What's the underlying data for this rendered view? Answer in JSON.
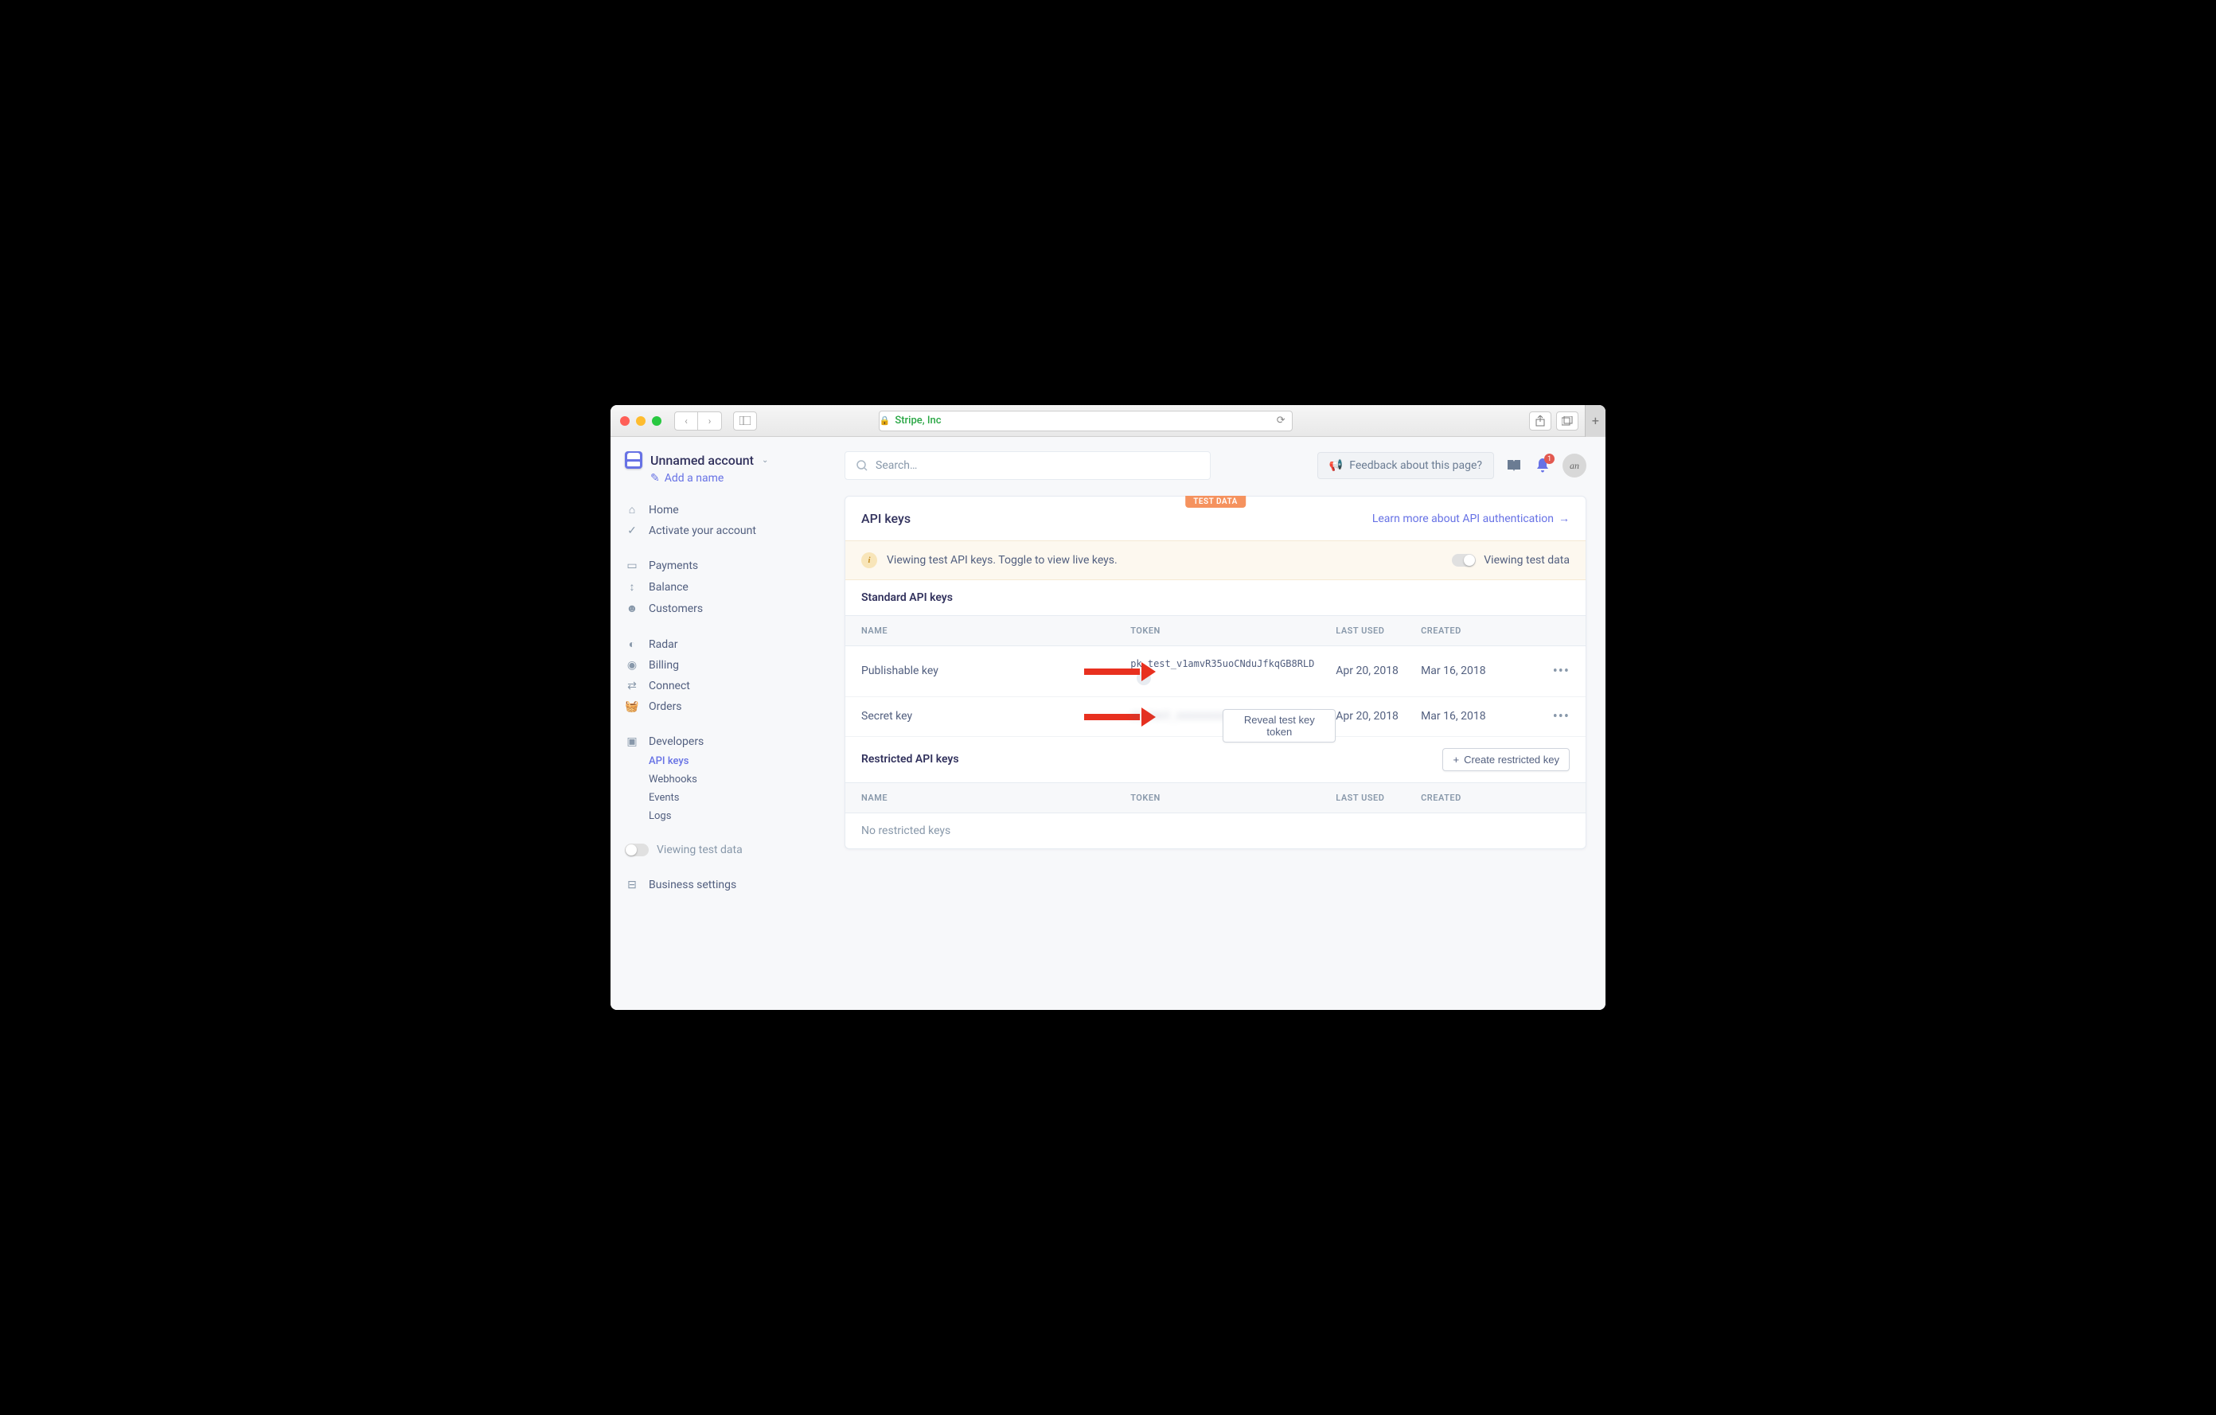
{
  "browser": {
    "url_label": "Stripe, Inc"
  },
  "account": {
    "name": "Unnamed account",
    "add_name_label": "Add a name"
  },
  "nav": {
    "home": "Home",
    "activate": "Activate your account",
    "payments": "Payments",
    "balance": "Balance",
    "customers": "Customers",
    "radar": "Radar",
    "billing": "Billing",
    "connect": "Connect",
    "orders": "Orders",
    "developers": "Developers",
    "api_keys": "API keys",
    "webhooks": "Webhooks",
    "events": "Events",
    "logs": "Logs",
    "viewing_test": "Viewing test data",
    "business_settings": "Business settings"
  },
  "topbar": {
    "search_placeholder": "Search…",
    "feedback": "Feedback about this page?",
    "notif_count": "1",
    "avatar_initials": "an"
  },
  "panel": {
    "test_badge": "TEST DATA",
    "title": "API keys",
    "learn_more": "Learn more about API authentication",
    "info_text": "Viewing test API keys. Toggle to view live keys.",
    "info_toggle_label": "Viewing test data",
    "standard_title": "Standard API keys",
    "restricted_title": "Restricted API keys",
    "create_restricted": "Create restricted key",
    "empty_restricted": "No restricted keys",
    "headers": {
      "name": "NAME",
      "token": "TOKEN",
      "last_used": "LAST USED",
      "created": "CREATED"
    },
    "rows": [
      {
        "name": "Publishable key",
        "token": "pk_test_v1amvR35uoCNduJfkqGB8RLD",
        "last_used": "Apr 20, 2018",
        "created": "Mar 16, 2018"
      },
      {
        "name": "Secret key",
        "reveal_label": "Reveal test key token",
        "blurred_token": "sk_test_xxxxxxxxxxxxxxxxxxxxxxxx",
        "last_used": "Apr 20, 2018",
        "created": "Mar 16, 2018"
      }
    ]
  }
}
